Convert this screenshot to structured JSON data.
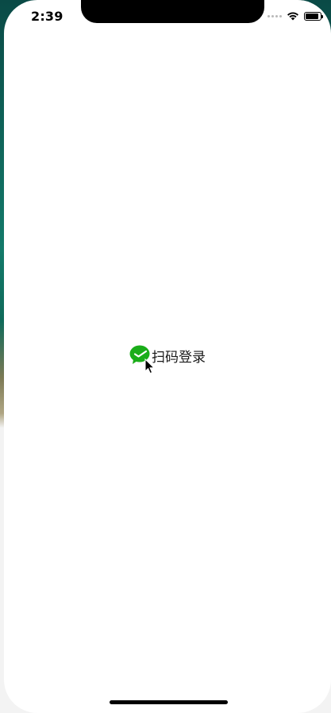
{
  "status_bar": {
    "time": "2:39",
    "icons": [
      "cellular-signal-icon",
      "wifi-icon",
      "battery-icon"
    ],
    "battery_level": 0.9
  },
  "main": {
    "login_button": {
      "icon": "wechat-icon",
      "label": "扫码登录"
    }
  },
  "colors": {
    "wechat_green": "#1aad19",
    "background": "#ffffff",
    "text": "#1a1a1a"
  }
}
